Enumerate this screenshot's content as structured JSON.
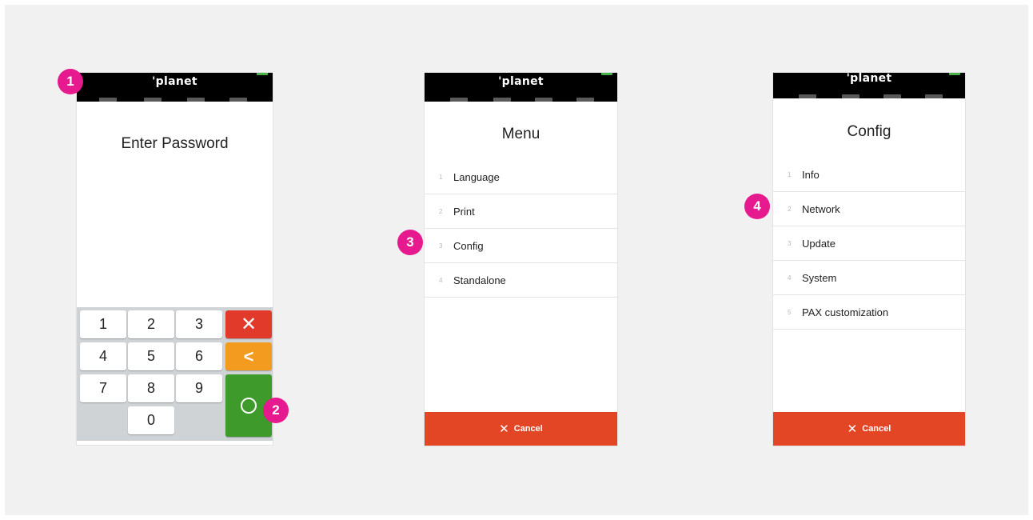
{
  "colors": {
    "background": "#f1f1f1",
    "header": "#000000",
    "battery": "#47b249",
    "key_cancel": "#e13a2b",
    "key_back": "#f39b1f",
    "key_ok": "#3d9a2b",
    "cancel_bar": "#e24624",
    "badge": "#e6198e"
  },
  "brand": "'planet",
  "screen1": {
    "title": "Enter Password",
    "keys": [
      "1",
      "2",
      "3",
      "4",
      "5",
      "6",
      "7",
      "8",
      "9",
      "0"
    ],
    "cancel_icon": "close-icon",
    "back_icon": "chevron-left-icon",
    "ok_icon": "circle-icon"
  },
  "screen2": {
    "title": "Menu",
    "items": [
      {
        "num": "1",
        "label": "Language"
      },
      {
        "num": "2",
        "label": "Print"
      },
      {
        "num": "3",
        "label": "Config"
      },
      {
        "num": "4",
        "label": "Standalone"
      }
    ],
    "cancel_label": "Cancel"
  },
  "screen3": {
    "title": "Config",
    "items": [
      {
        "num": "1",
        "label": "Info"
      },
      {
        "num": "2",
        "label": "Network"
      },
      {
        "num": "3",
        "label": "Update"
      },
      {
        "num": "4",
        "label": "System"
      },
      {
        "num": "5",
        "label": "PAX customization"
      }
    ],
    "cancel_label": "Cancel"
  },
  "badges": [
    "1",
    "2",
    "3",
    "4"
  ]
}
